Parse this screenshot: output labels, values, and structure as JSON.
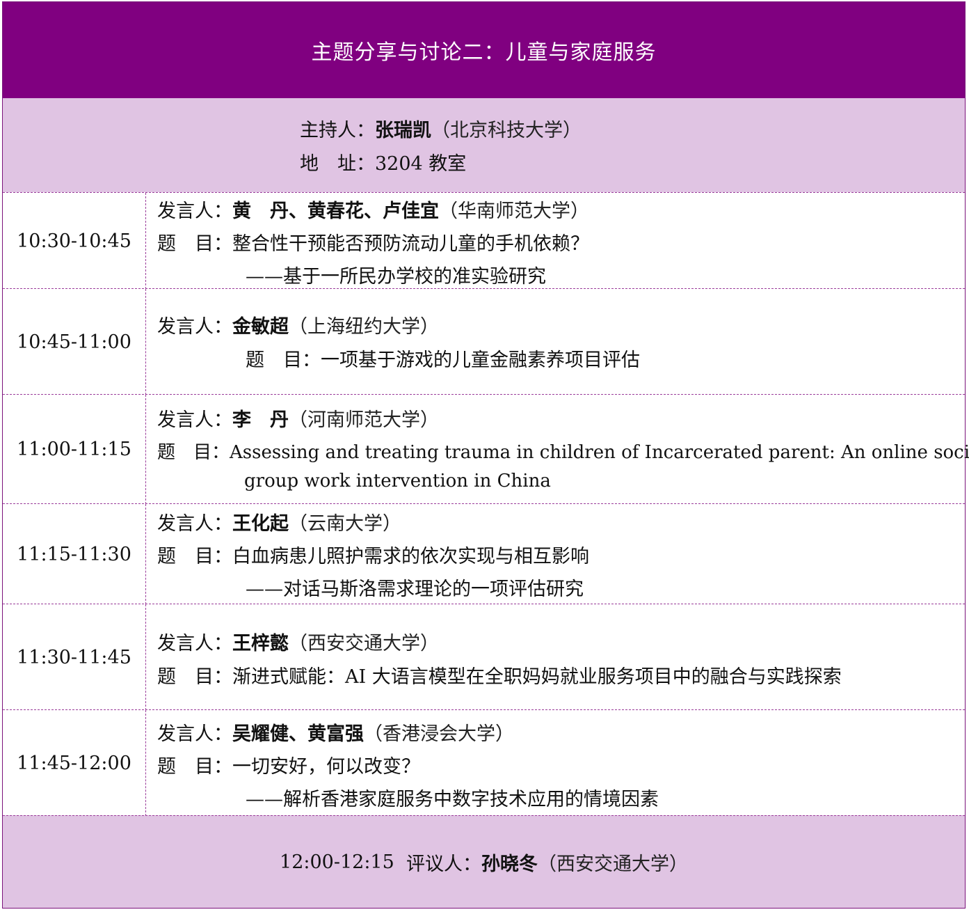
{
  "title": "主题分享与讨论二：儿童与家庭服务",
  "host": {
    "label": "主持人：",
    "name": "张瑞凯",
    "affiliation": "（北京科技大学）",
    "location_label": "地　址：",
    "location": "3204 教室"
  },
  "sessions": [
    {
      "time": "10:30-10:45",
      "speaker_label": "发言人：",
      "speakers": "黄　丹、黄春花、卢佳宜",
      "affiliation": "（华南师范大学）",
      "topic_label": "题　目：",
      "topic": "整合性干预能否预防流动儿童的手机依赖？",
      "subtopic": "——基于一所民办学校的准实验研究"
    },
    {
      "time": "10:45-11:00",
      "speaker_label": "发言人：",
      "speakers": "金敏超",
      "affiliation": "（上海纽约大学）",
      "topic_label": "题　目：",
      "topic": "一项基于游戏的儿童金融素养项目评估"
    },
    {
      "time": "11:00-11:15",
      "speaker_label": "发言人：",
      "speakers": "李　丹",
      "affiliation": "（河南师范大学）",
      "topic_label": "题　目：",
      "topic": "Assessing and treating trauma in children of Incarcerated parent: An online social",
      "subtopic": "group work intervention in China"
    },
    {
      "time": "11:15-11:30",
      "speaker_label": "发言人：",
      "speakers": "王化起",
      "affiliation": "（云南大学）",
      "topic_label": "题　目：",
      "topic": "白血病患儿照护需求的依次实现与相互影响",
      "subtopic": "——对话马斯洛需求理论的一项评估研究"
    },
    {
      "time": "11:30-11:45",
      "speaker_label": "发言人：",
      "speakers": "王梓懿",
      "affiliation": "（西安交通大学）",
      "topic_label": "题　目：",
      "topic": "渐进式赋能：AI 大语言模型在全职妈妈就业服务项目中的融合与实践探索"
    },
    {
      "time": "11:45-12:00",
      "speaker_label": "发言人：",
      "speakers": "吴耀健、黄富强",
      "affiliation": "（香港浸会大学）",
      "topic_label": "题　目：",
      "topic": "一切安好，何以改变？",
      "subtopic": "——解析香港家庭服务中数字技术应用的情境因素"
    }
  ],
  "commentary": {
    "time": "12:00-12:15",
    "label": "评议人：",
    "name": "孙晓冬",
    "affiliation": "（西安交通大学）"
  }
}
